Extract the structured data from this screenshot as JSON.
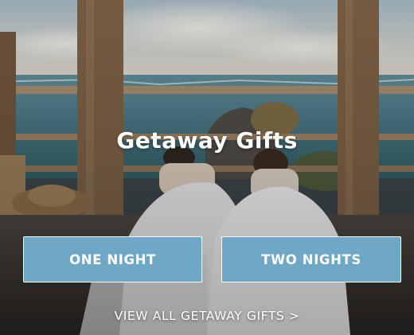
{
  "hero": {
    "title": "Getaway Gifts",
    "background_image": "couple-in-bed-ocean-view"
  },
  "buttons": {
    "one_night_label": "ONE NIGHT",
    "two_nights_label": "TWO NIGHTS"
  },
  "links": {
    "view_all_label": "VIEW ALL GETAWAY GIFTS >"
  },
  "colors": {
    "button_fill": "#6ea8c6",
    "button_border": "#ffffff",
    "text": "#ffffff"
  }
}
